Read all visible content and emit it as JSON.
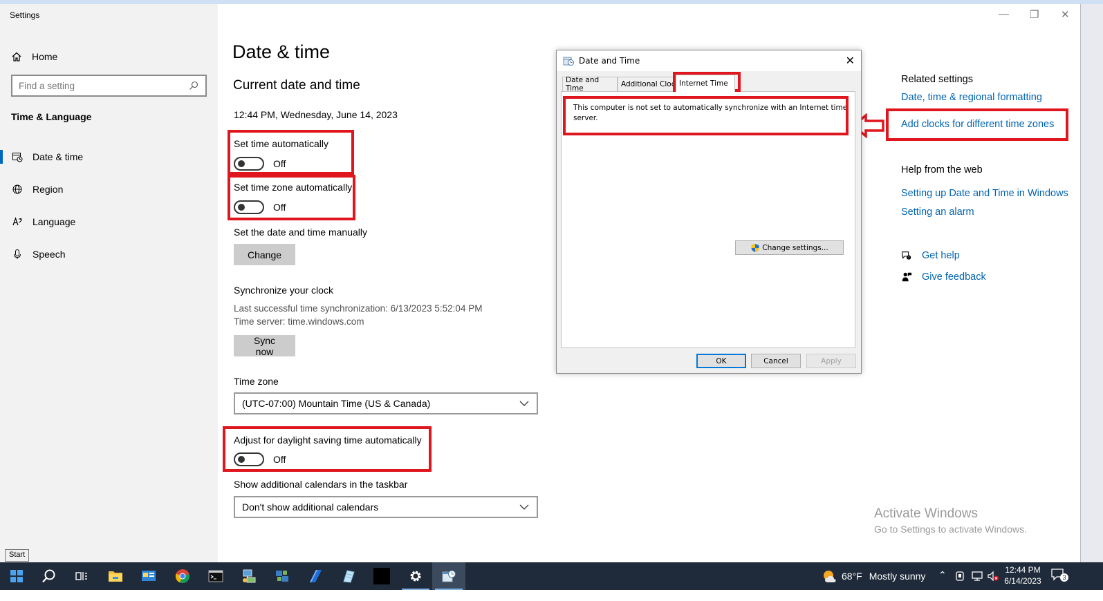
{
  "window": {
    "app_title": "Settings",
    "controls": {
      "minimize": "—",
      "restore": "❐",
      "close": "✕"
    }
  },
  "nav": {
    "home_label": "Home",
    "search_placeholder": "Find a setting",
    "section": "Time & Language",
    "items": [
      {
        "label": "Date & time",
        "icon": "calendar-clock-icon",
        "active": true
      },
      {
        "label": "Region",
        "icon": "globe-icon",
        "active": false
      },
      {
        "label": "Language",
        "icon": "language-icon",
        "active": false
      },
      {
        "label": "Speech",
        "icon": "microphone-icon",
        "active": false
      }
    ]
  },
  "tooltip": {
    "start": "Start"
  },
  "main": {
    "title": "Date & time",
    "section_title": "Current date and time",
    "current_datetime": "12:44 PM, Wednesday, June 14, 2023",
    "set_time_auto": {
      "label": "Set time automatically",
      "state": "Off"
    },
    "set_timezone_auto": {
      "label": "Set time zone automatically",
      "state": "Off"
    },
    "manual_label": "Set the date and time manually",
    "change_button": "Change",
    "sync": {
      "heading": "Synchronize your clock",
      "last_sync": "Last successful time synchronization: 6/13/2023 5:52:04 PM",
      "server": "Time server: time.windows.com",
      "button": "Sync now"
    },
    "timezone": {
      "label": "Time zone",
      "value": "(UTC-07:00) Mountain Time (US & Canada)"
    },
    "dst": {
      "label": "Adjust for daylight saving time automatically",
      "state": "Off"
    },
    "calendars": {
      "label": "Show additional calendars in the taskbar",
      "value": "Don't show additional calendars"
    }
  },
  "related": {
    "heading": "Related settings",
    "links": [
      "Date, time & regional formatting",
      "Add clocks for different time zones"
    ],
    "web_heading": "Help from the web",
    "web_links": [
      "Setting up Date and Time in Windows",
      "Setting an alarm"
    ],
    "get_help": "Get help",
    "give_feedback": "Give feedback"
  },
  "activation": {
    "title": "Activate Windows",
    "subtitle": "Go to Settings to activate Windows."
  },
  "dialog": {
    "title": "Date and Time",
    "close": "✕",
    "tabs": [
      "Date and Time",
      "Additional Clocks",
      "Internet Time"
    ],
    "active_tab": "Internet Time",
    "message": "This computer is not set to automatically synchronize with an Internet time server.",
    "change_settings": "Change settings...",
    "ok": "OK",
    "cancel": "Cancel",
    "apply": "Apply"
  },
  "taskbar": {
    "apps": [
      "start-icon",
      "search-icon",
      "task-view-icon",
      "file-explorer-icon",
      "control-panel-icon",
      "chrome-icon",
      "terminal-icon",
      "network-admin-icon",
      "server-tools-icon",
      "app-blue-icon",
      "app-notepad-icon",
      "app-black-icon",
      "settings-gear-icon",
      "date-time-app-icon"
    ],
    "weather": {
      "temp": "68°F",
      "condition": "Mostly sunny"
    },
    "clock": {
      "time": "12:44 PM",
      "date": "6/14/2023"
    },
    "notifications": "3"
  },
  "colors": {
    "annotation": "#e0161e",
    "link": "#0063b1",
    "accent": "#0067c0",
    "taskbar": "#1f2b3a"
  }
}
